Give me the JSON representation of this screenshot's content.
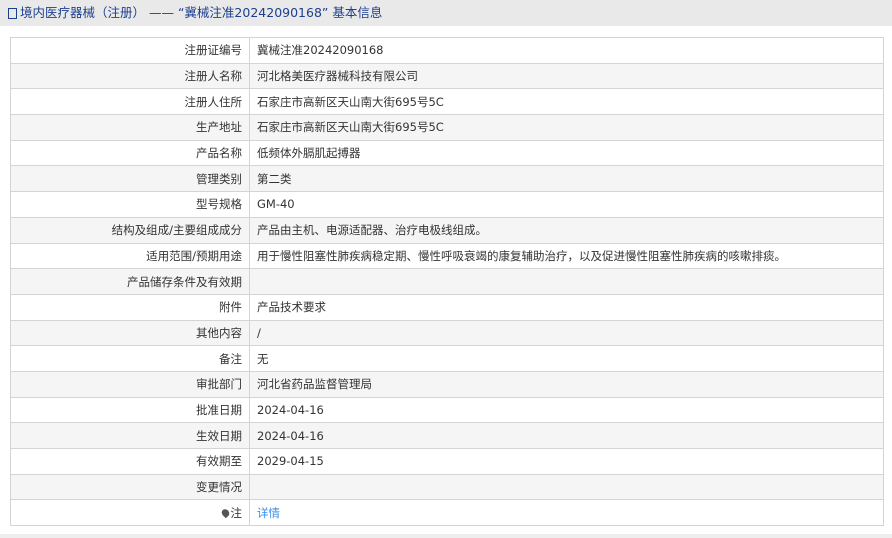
{
  "header": {
    "title": "境内医疗器械（注册） —— “冀械注准20242090168” 基本信息"
  },
  "rows": [
    {
      "label": "注册证编号",
      "value": "冀械注准20242090168"
    },
    {
      "label": "注册人名称",
      "value": "河北格美医疗器械科技有限公司"
    },
    {
      "label": "注册人住所",
      "value": "石家庄市高新区天山南大街695号5C"
    },
    {
      "label": "生产地址",
      "value": "石家庄市高新区天山南大街695号5C"
    },
    {
      "label": "产品名称",
      "value": "低频体外膈肌起搏器"
    },
    {
      "label": "管理类别",
      "value": "第二类"
    },
    {
      "label": "型号规格",
      "value": "GM-40"
    },
    {
      "label": "结构及组成/主要组成成分",
      "value": "产品由主机、电源适配器、治疗电极线组成。"
    },
    {
      "label": "适用范围/预期用途",
      "value": "用于慢性阻塞性肺疾病稳定期、慢性呼吸衰竭的康复辅助治疗，以及促进慢性阻塞性肺疾病的咳嗽排痰。"
    },
    {
      "label": "产品储存条件及有效期",
      "value": ""
    },
    {
      "label": "附件",
      "value": "产品技术要求"
    },
    {
      "label": "其他内容",
      "value": "/"
    },
    {
      "label": "备注",
      "value": "无"
    },
    {
      "label": "审批部门",
      "value": "河北省药品监督管理局"
    },
    {
      "label": "批准日期",
      "value": "2024-04-16"
    },
    {
      "label": "生效日期",
      "value": "2024-04-16"
    },
    {
      "label": "有效期至",
      "value": "2029-04-15"
    },
    {
      "label": "变更情况",
      "value": ""
    }
  ],
  "note": {
    "label": "注",
    "link": "详情"
  }
}
